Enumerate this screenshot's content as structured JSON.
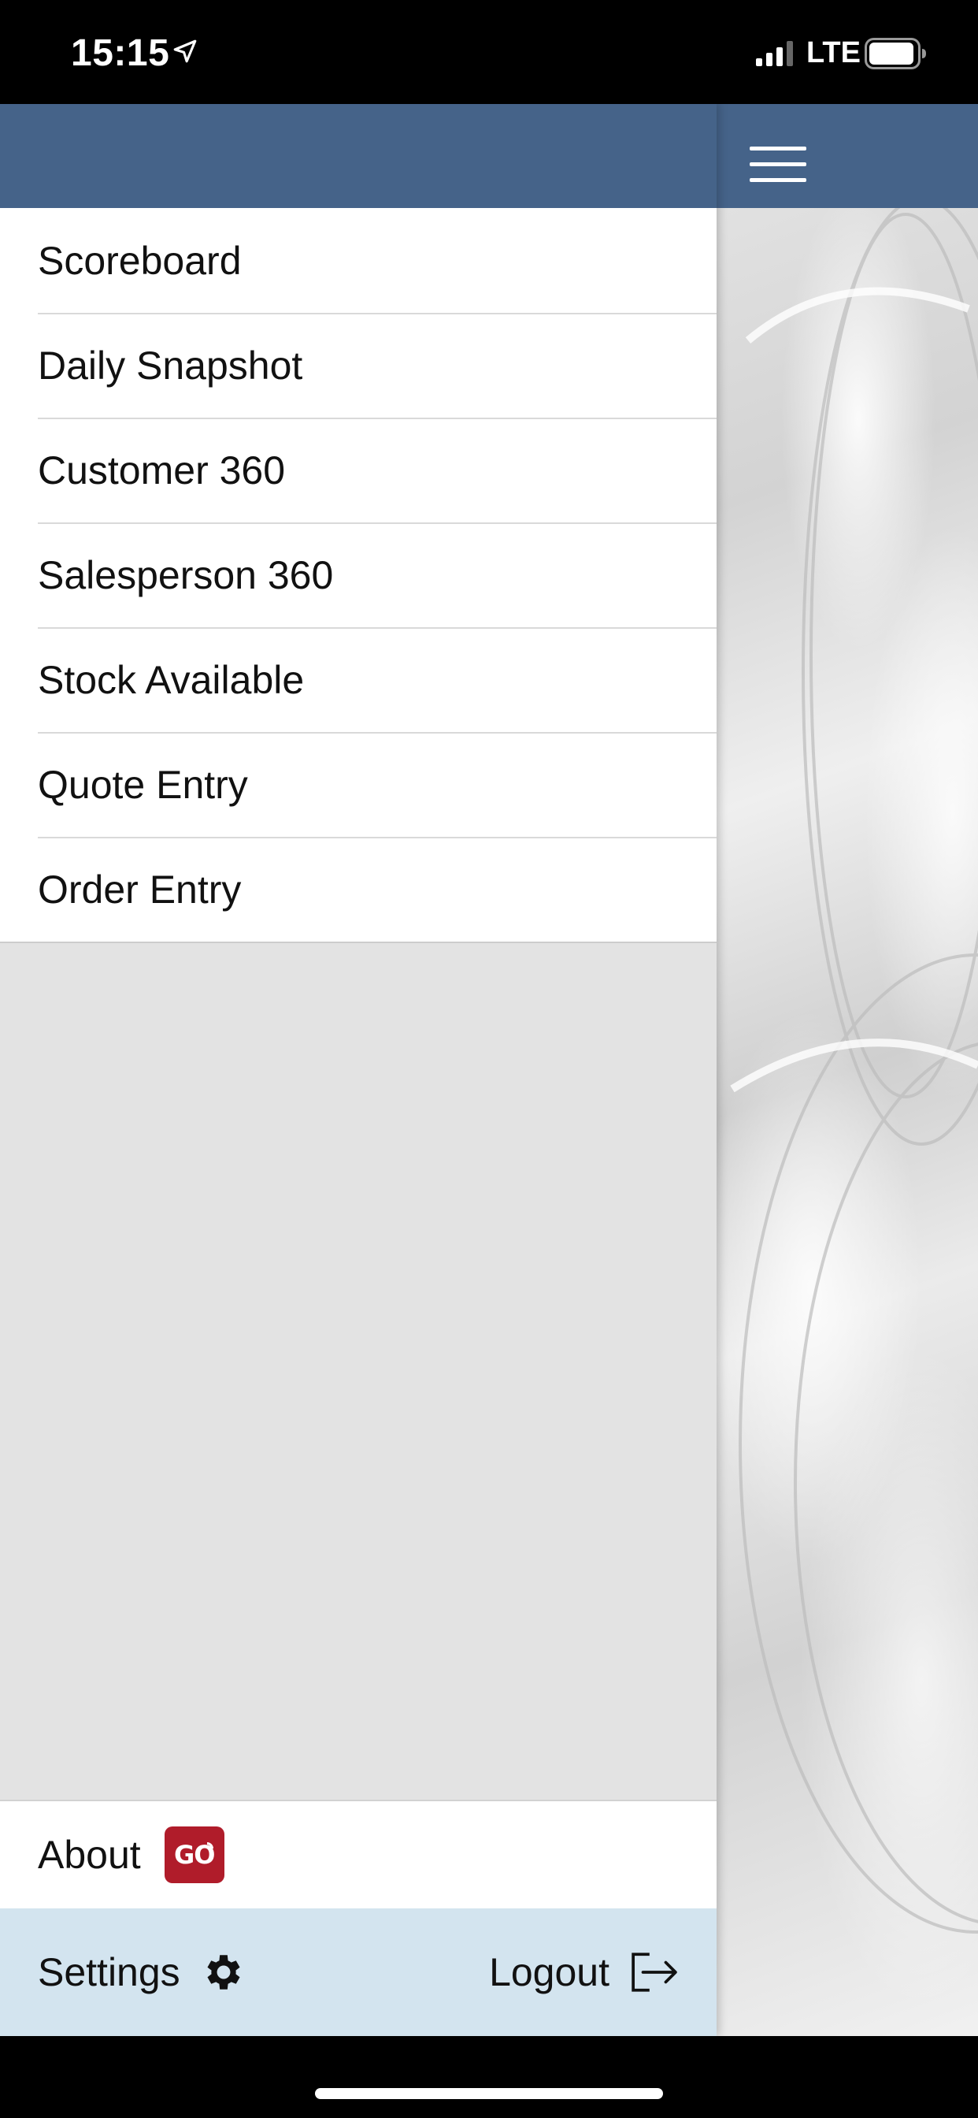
{
  "status_bar": {
    "time": "15:15",
    "network": "LTE",
    "icons": [
      "location-arrow-icon",
      "signal-icon",
      "battery-icon"
    ]
  },
  "header": {
    "menu_icon": "hamburger-menu-icon",
    "color": "#456389"
  },
  "menu": {
    "items": [
      {
        "label": "Scoreboard"
      },
      {
        "label": "Daily Snapshot"
      },
      {
        "label": "Customer 360"
      },
      {
        "label": "Salesperson 360"
      },
      {
        "label": "Stock Available"
      },
      {
        "label": "Quote Entry"
      },
      {
        "label": "Order Entry"
      }
    ]
  },
  "about": {
    "label": "About",
    "badge_text": "GO",
    "badge_color": "#b01c2a"
  },
  "footer": {
    "settings_label": "Settings",
    "logout_label": "Logout",
    "background": "#d3e4ef"
  }
}
